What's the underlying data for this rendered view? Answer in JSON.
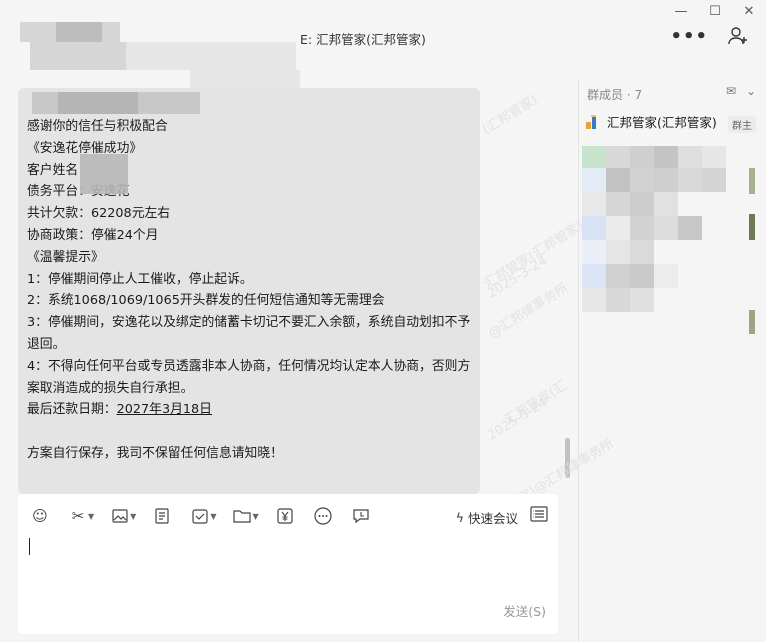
{
  "window": {
    "minimize_icon": "minimize-icon",
    "maximize_icon": "maximize-icon",
    "close_icon": "close-icon"
  },
  "header": {
    "title": "E: 汇邦管家(汇邦管家)",
    "more_icon": "more-icon",
    "add_member_icon": "add-user-icon"
  },
  "message": {
    "lines": [
      "感谢你的信任与积极配合",
      "《安逸花停催成功》",
      "客户姓名",
      "债务平台：安逸花",
      "共计欠款：62208元左右",
      "协商政策：停催24个月",
      "《温馨提示》",
      "1：停催期间停止人工催收，停止起诉。",
      "2：系统1068/1069/1065开头群发的任何短信通知等无需理会",
      "3：停催期间，安逸花以及绑定的储蓄卡切记不要汇入余额，系统自动划扣不予退回。",
      "4：不得向任何平台或专员透露非本人协商，任何情况均认定本人协商，否则方案取消造成的损失自行承担。",
      "最后还款日期：",
      "2027年3月18日",
      "方案自行保存，我司不保留任何信息请知晓！"
    ]
  },
  "composer": {
    "tools": [
      "emoji-icon",
      "scissors-icon",
      "image-icon",
      "document-icon",
      "checkbox-icon",
      "folder-icon",
      "yen-icon",
      "more-circle-icon",
      "comment-icon"
    ],
    "meeting_label": "快速会议",
    "send_label": "发送(S)"
  },
  "members": {
    "title": "群成员 · 7",
    "first_member": "汇邦管家(汇邦管家)",
    "owner_badge": "群主"
  },
  "watermarks": [
    "(汇邦管家)",
    "汇邦管家(汇邦管家)",
    "2025-3-24",
    "@汇邦律事务所",
    "汇邦管家(汇",
    "2025-3-24",
    "(汇邦管家)@汇邦律事务所"
  ],
  "colors": {
    "bubble": "#e4e4e4",
    "background": "#f5f5f5",
    "composer": "#ffffff"
  }
}
